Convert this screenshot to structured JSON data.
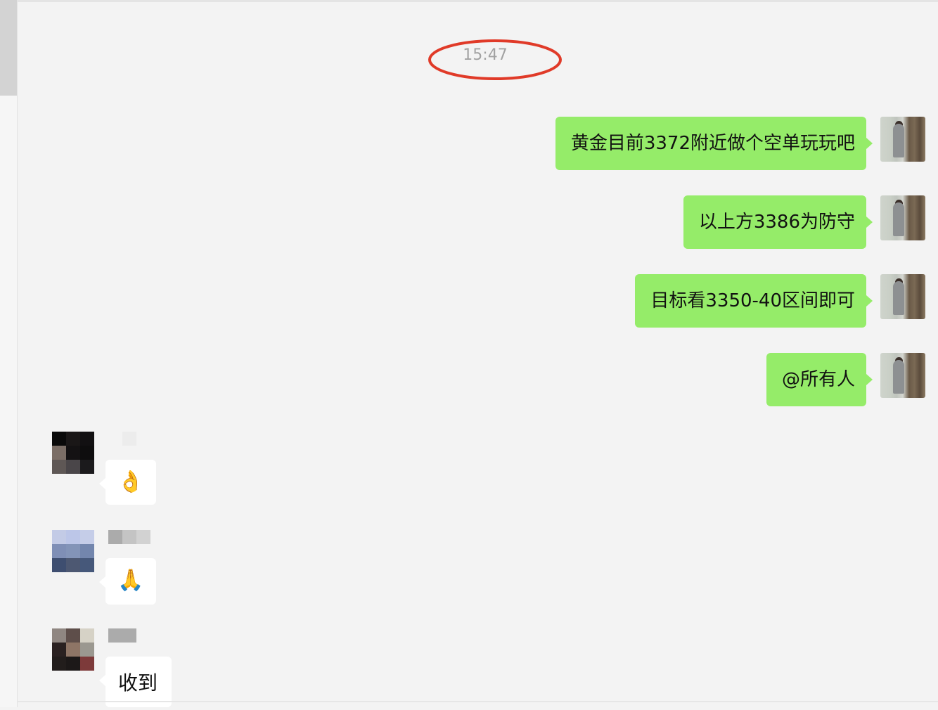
{
  "timestamp": "15:47",
  "outgoing_messages": [
    {
      "text": "黄金目前3372附近做个空单玩玩吧"
    },
    {
      "text": "以上方3386为防守"
    },
    {
      "text": "目标看3350-40区间即可"
    },
    {
      "text": "@所有人"
    }
  ],
  "incoming_messages": [
    {
      "emoji": "👌"
    },
    {
      "emoji": "🙏"
    },
    {
      "text": "收到"
    }
  ],
  "colors": {
    "outgoing_bubble": "#95ec69",
    "incoming_bubble": "#ffffff",
    "background": "#f3f3f3",
    "highlight_circle": "#e03a28"
  }
}
